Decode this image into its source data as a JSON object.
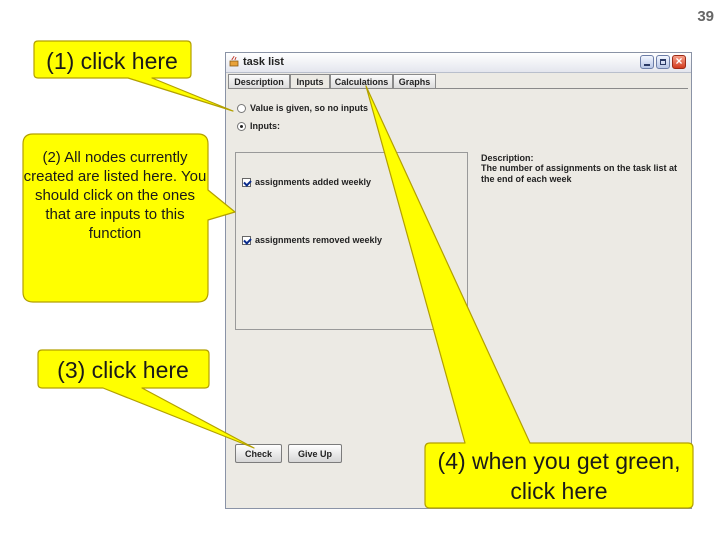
{
  "slide_number": "39",
  "window": {
    "title": "task list",
    "tabs": [
      "Description",
      "Inputs",
      "Calculations",
      "Graphs"
    ],
    "active_tab": "Inputs"
  },
  "inputs_tab": {
    "radio_given": "Value is given, so no inputs",
    "radio_inputs": "Inputs:",
    "selected_radio": "Inputs:",
    "nodes": [
      {
        "label": "assignments added weekly",
        "checked": true
      },
      {
        "label": "assignments removed weekly",
        "checked": true
      }
    ],
    "description_heading": "Description:",
    "description_text": "The number of assignments on the task list at the end of each week",
    "check_button": "Check",
    "giveup_button": "Give Up"
  },
  "callouts": {
    "c1": "(1) click here",
    "c2": "(2) All nodes currently created are listed here. You should click on the ones that are inputs to this function",
    "c3": "(3) click here",
    "c4": "(4) when you get green, click here",
    "fill_color": "#ffff00",
    "border_color": "#b3a000"
  }
}
